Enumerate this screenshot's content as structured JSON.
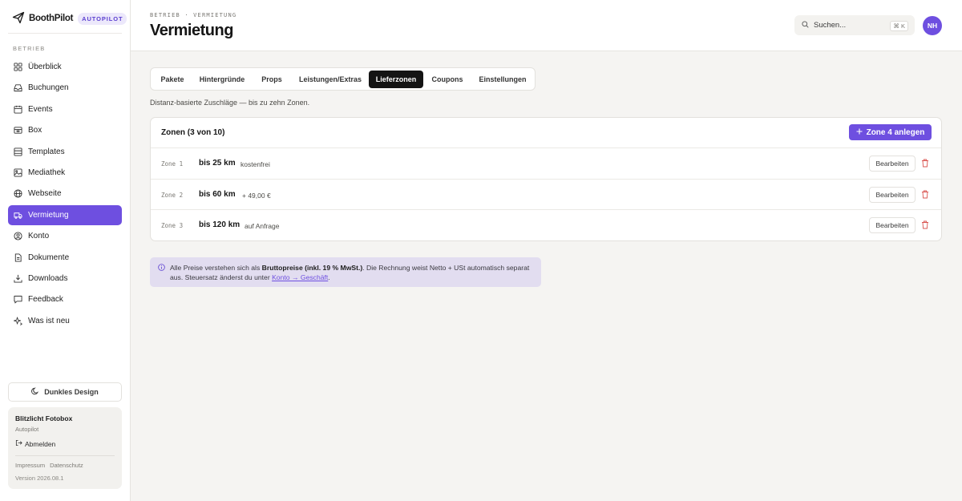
{
  "brand": {
    "name": "BoothPilot",
    "badge": "AUTOPILOT"
  },
  "sidebar": {
    "section": "BETRIEB",
    "items": [
      {
        "label": "Überblick",
        "icon": "grid-icon"
      },
      {
        "label": "Buchungen",
        "icon": "inbox-icon"
      },
      {
        "label": "Events",
        "icon": "calendar-icon"
      },
      {
        "label": "Box",
        "icon": "box-icon"
      },
      {
        "label": "Templates",
        "icon": "layout-icon"
      },
      {
        "label": "Mediathek",
        "icon": "image-icon"
      },
      {
        "label": "Webseite",
        "icon": "globe-icon"
      },
      {
        "label": "Vermietung",
        "icon": "truck-icon",
        "active": true
      },
      {
        "label": "Konto",
        "icon": "user-icon"
      },
      {
        "label": "Dokumente",
        "icon": "file-icon"
      },
      {
        "label": "Downloads",
        "icon": "download-icon"
      },
      {
        "label": "Feedback",
        "icon": "message-icon"
      },
      {
        "label": "Was ist neu",
        "icon": "sparkle-icon"
      }
    ],
    "dark_mode_label": "Dunkles Design",
    "account": {
      "name": "Blitzlicht Fotobox",
      "plan": "Autopilot",
      "logout": "Abmelden",
      "links": [
        "Impressum",
        "Datenschutz"
      ],
      "version": "Version 2026.08.1"
    }
  },
  "header": {
    "breadcrumb": "BETRIEB · VERMIETUNG",
    "title": "Vermietung",
    "search_placeholder": "Suchen...",
    "search_shortcut": "⌘ K",
    "avatar_initials": "NH"
  },
  "tabs": [
    {
      "label": "Pakete"
    },
    {
      "label": "Hintergründe"
    },
    {
      "label": "Props"
    },
    {
      "label": "Leistungen/Extras"
    },
    {
      "label": "Lieferzonen",
      "active": true
    },
    {
      "label": "Coupons"
    },
    {
      "label": "Einstellungen"
    }
  ],
  "subtitle": "Distanz-basierte Zuschläge — bis zu zehn Zonen.",
  "zones": {
    "title": "Zonen (3 von 10)",
    "add_label": "Zone 4 anlegen",
    "edit_label": "Bearbeiten",
    "rows": [
      {
        "zone": "Zone 1",
        "distance": "bis 25 km",
        "price": "kostenfrei"
      },
      {
        "zone": "Zone 2",
        "distance": "bis 60 km",
        "price": "+ 49,00 €"
      },
      {
        "zone": "Zone 3",
        "distance": "bis 120 km",
        "price": "auf Anfrage"
      }
    ]
  },
  "info": {
    "pre": "Alle Preise verstehen sich als ",
    "bold": "Bruttopreise (inkl. 19 % MwSt.)",
    "mid": ". Die Rechnung weist Netto + USt automatisch separat aus. Steuersatz änderst du unter ",
    "link": "Konto → Geschäft",
    "post": "."
  },
  "colors": {
    "accent": "#6e4fe0",
    "active_tab": "#141414",
    "info_bg": "#e2ddf0",
    "delete": "#d9534f"
  }
}
